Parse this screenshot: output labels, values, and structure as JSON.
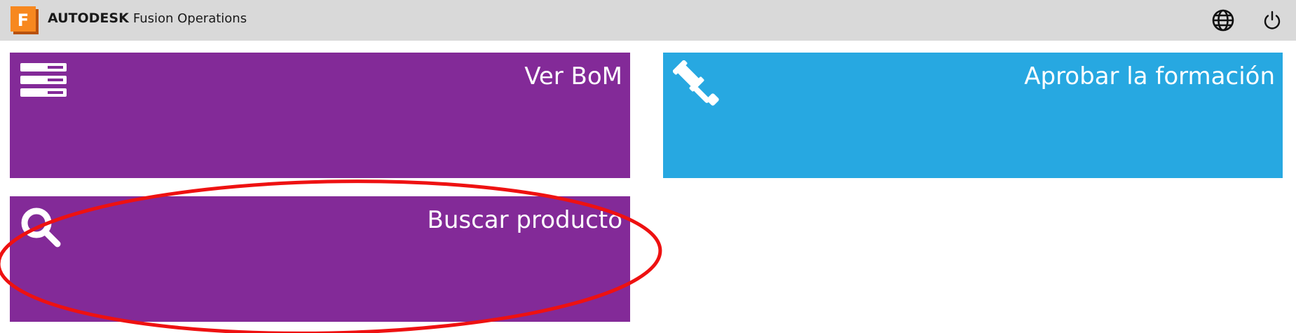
{
  "header": {
    "brand_bold": "AUTODESK",
    "brand_product": "Fusion Operations",
    "logo_letter": "F",
    "logo_icon": "fusion-logo-icon",
    "language_icon": "globe-icon",
    "power_icon": "power-icon"
  },
  "tiles": [
    {
      "label": "Ver BoM",
      "icon": "bom-list-icon",
      "color": "#832a98"
    },
    {
      "label": "Aprobar la formación",
      "icon": "gavel-icon",
      "color": "#27a8e1"
    },
    {
      "label": "Buscar producto",
      "icon": "search-icon",
      "color": "#832a98"
    }
  ],
  "annotation": {
    "color": "#ee1111",
    "shape": "ellipse"
  }
}
